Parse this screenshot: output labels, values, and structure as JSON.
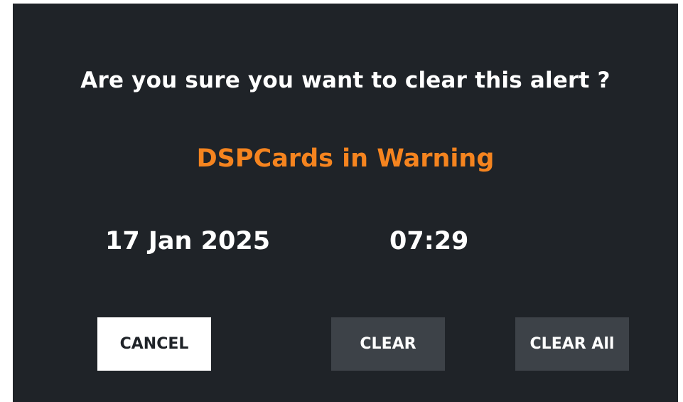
{
  "dialog": {
    "question": "Are you sure you want to clear this alert ?",
    "alert_name": "DSPCards in Warning",
    "date": "17 Jan 2025",
    "time": "07:29"
  },
  "buttons": {
    "cancel_label": "CANCEL",
    "clear_label": "CLEAR",
    "clear_all_label": "CLEAR All"
  },
  "colors": {
    "background": "#1f2328",
    "alert_accent": "#f5841f",
    "button_dark": "#3d4248",
    "button_light": "#ffffff"
  }
}
